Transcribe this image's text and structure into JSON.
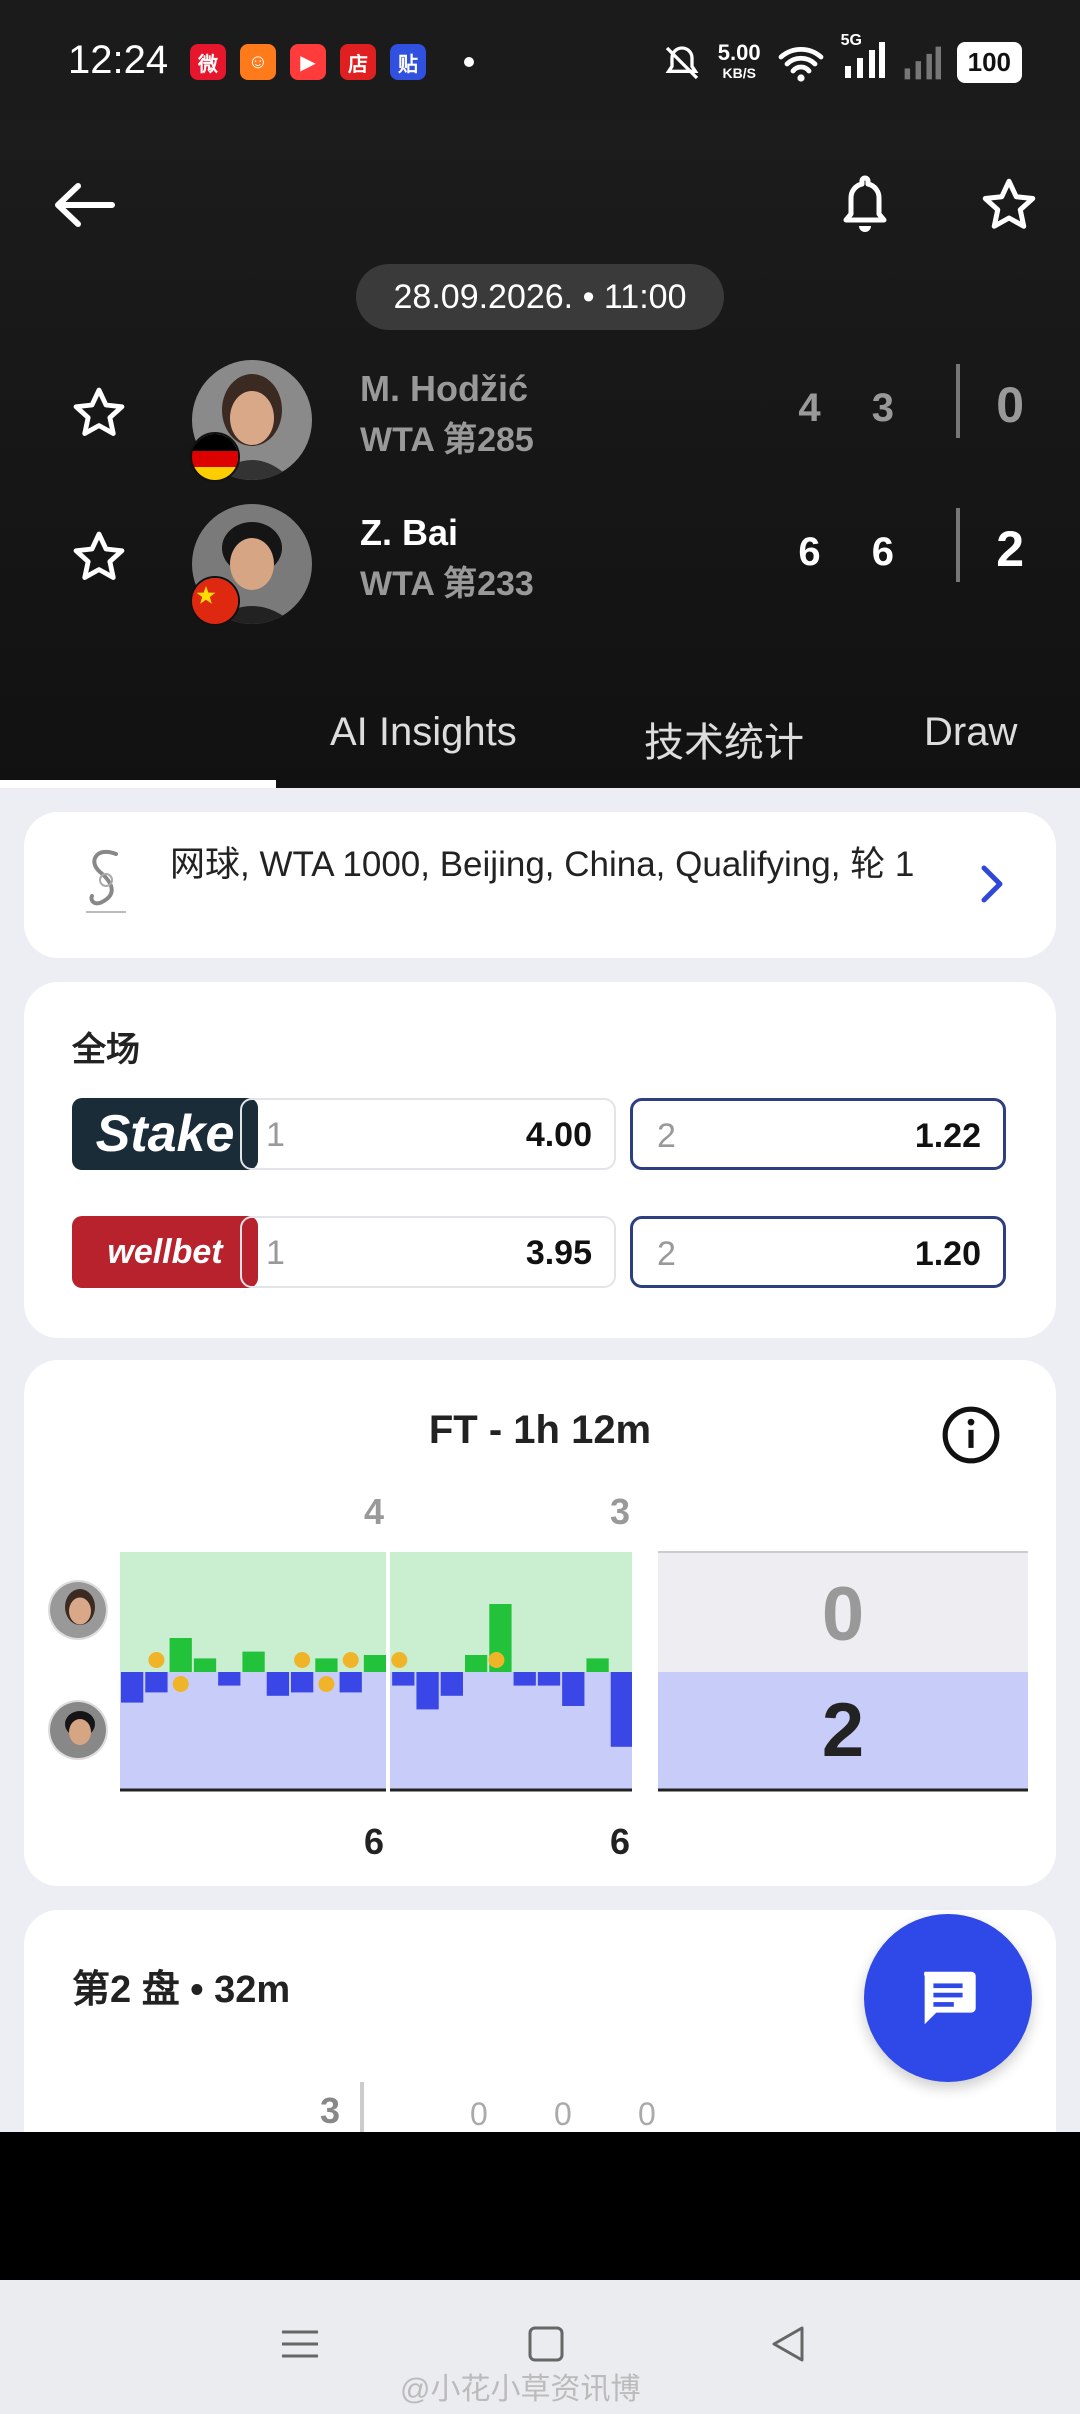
{
  "status_bar": {
    "time": "12:24",
    "app_icons": [
      {
        "name": "weibo-icon",
        "color": "#e6162d",
        "glyph": "微"
      },
      {
        "name": "app-orange-icon",
        "color": "#ff7a1a",
        "glyph": "☺"
      },
      {
        "name": "video-app-icon",
        "color": "#ff3b3b",
        "glyph": "▶"
      },
      {
        "name": "store-app-icon",
        "color": "#e02020",
        "glyph": "店"
      },
      {
        "name": "tieba-icon",
        "color": "#3050e0",
        "glyph": "贴"
      }
    ],
    "net_speed": "5.00",
    "net_unit": "KB/S",
    "network": "5G",
    "battery": "100"
  },
  "header": {
    "date": "28.09.2026. • 11:00",
    "players": [
      {
        "name": "M. Hodžić",
        "rank": "WTA 第285",
        "sets": "4 3",
        "total": "0",
        "flag": "germany-flag",
        "winner": false
      },
      {
        "name": "Z. Bai",
        "rank": "WTA 第233",
        "sets": "6 6",
        "total": "2",
        "flag": "china-flag",
        "winner": true
      }
    ],
    "tabs": [
      "AI Insights",
      "技术统计",
      "Draw"
    ]
  },
  "tournament": {
    "text": "网球, WTA 1000, Beijing, China, Qualifying, 轮 1"
  },
  "odds": {
    "title": "全场",
    "bookmakers": [
      {
        "name": "Stake",
        "color": "#1a2c38",
        "odds": [
          {
            "label": "1",
            "value": "4.00",
            "selected": false
          },
          {
            "label": "2",
            "value": "1.22",
            "selected": true
          }
        ]
      },
      {
        "name": "wellbet",
        "color": "#b8222c",
        "odds": [
          {
            "label": "1",
            "value": "3.95",
            "selected": false
          },
          {
            "label": "2",
            "value": "1.20",
            "selected": true
          }
        ]
      }
    ]
  },
  "momentum": {
    "title": "FT - 1h 12m",
    "set_scores_top": [
      "4",
      "3"
    ],
    "set_scores_bottom": [
      "6",
      "6"
    ],
    "final_top": "0",
    "final_bottom": "2",
    "colors": {
      "top": "#22c33a",
      "bottom": "#3a47e6",
      "top_bg": "#c9eed0",
      "bottom_bg": "#c8ccf8"
    },
    "bars": [
      -0.45,
      -0.3,
      0.5,
      0.2,
      -0.2,
      0.3,
      -0.35,
      -0.3,
      0.2,
      -0.3,
      0.25,
      -0.2,
      -0.55,
      -0.35,
      0.25,
      1.0,
      -0.2,
      -0.2,
      -0.5,
      0.2,
      -1.1
    ],
    "set_break_after": 10,
    "coins_top": [
      1,
      7,
      9,
      11,
      15
    ],
    "coins_bottom": [
      2,
      8
    ]
  },
  "set2": {
    "title": "第2 盘 • 32m",
    "scores": [
      "3",
      "0",
      "0",
      "0"
    ]
  },
  "watermark": "@小花小草资讯博"
}
